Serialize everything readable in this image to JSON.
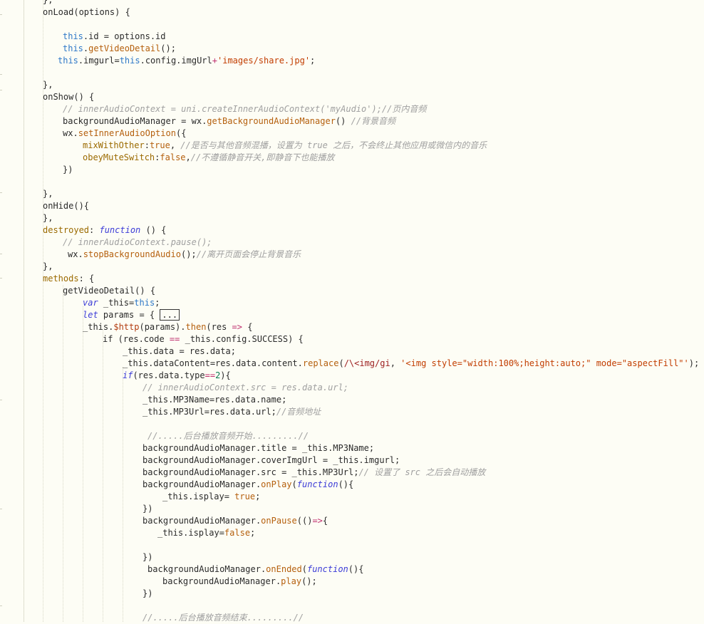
{
  "editor": {
    "lines": [
      [
        {
          "t": "plain",
          "v": "},"
        }
      ],
      [
        {
          "t": "plain",
          "v": "onLoad(options) {"
        }
      ],
      [],
      [
        {
          "t": "this",
          "v": "this"
        },
        {
          "t": "plain",
          "v": ".id = options.id"
        }
      ],
      [
        {
          "t": "this",
          "v": "this"
        },
        {
          "t": "plain",
          "v": "."
        },
        {
          "t": "fn",
          "v": "getVideoDetail"
        },
        {
          "t": "plain",
          "v": "();"
        }
      ],
      [
        {
          "t": "this",
          "v": "this"
        },
        {
          "t": "plain",
          "v": ".imgurl="
        },
        {
          "t": "this",
          "v": "this"
        },
        {
          "t": "plain",
          "v": ".config.imgUrl"
        },
        {
          "t": "op",
          "v": "+"
        },
        {
          "t": "str",
          "v": "'images/share.jpg'"
        },
        {
          "t": "plain",
          "v": ";"
        }
      ],
      [],
      [
        {
          "t": "plain",
          "v": "},"
        }
      ],
      [
        {
          "t": "plain",
          "v": "onShow() {"
        }
      ],
      [
        {
          "t": "comment",
          "v": "// innerAudioContext = uni.createInnerAudioContext('myAudio');//页内音频"
        }
      ],
      [
        {
          "t": "plain",
          "v": "backgroundAudioManager = wx."
        },
        {
          "t": "fn",
          "v": "getBackgroundAudioManager"
        },
        {
          "t": "plain",
          "v": "() "
        },
        {
          "t": "comment",
          "v": "//背景音频"
        }
      ],
      [
        {
          "t": "plain",
          "v": "wx."
        },
        {
          "t": "fn",
          "v": "setInnerAudioOption"
        },
        {
          "t": "plain",
          "v": "({"
        }
      ],
      [
        {
          "t": "prop",
          "v": "mixWithOther"
        },
        {
          "t": "plain",
          "v": ":"
        },
        {
          "t": "bool",
          "v": "true"
        },
        {
          "t": "plain",
          "v": ", "
        },
        {
          "t": "comment",
          "v": "//是否与其他音频混播，设置为 true 之后，不会终止其他应用或微信内的音乐"
        }
      ],
      [
        {
          "t": "prop",
          "v": "obeyMuteSwitch"
        },
        {
          "t": "plain",
          "v": ":"
        },
        {
          "t": "bool",
          "v": "false"
        },
        {
          "t": "plain",
          "v": ","
        },
        {
          "t": "comment",
          "v": "//不遵循静音开关,即静音下也能播放"
        }
      ],
      [
        {
          "t": "plain",
          "v": "})"
        }
      ],
      [],
      [
        {
          "t": "plain",
          "v": "},"
        }
      ],
      [
        {
          "t": "plain",
          "v": "onHide(){"
        }
      ],
      [
        {
          "t": "plain",
          "v": "},"
        }
      ],
      [
        {
          "t": "prop",
          "v": "destroyed"
        },
        {
          "t": "plain",
          "v": ": "
        },
        {
          "t": "kw",
          "v": "function"
        },
        {
          "t": "plain",
          "v": " () {"
        }
      ],
      [
        {
          "t": "comment",
          "v": "// innerAudioContext.pause();"
        }
      ],
      [
        {
          "t": "plain",
          "v": "wx."
        },
        {
          "t": "fn",
          "v": "stopBackgroundAudio"
        },
        {
          "t": "plain",
          "v": "();"
        },
        {
          "t": "comment",
          "v": "//离开页面会停止背景音乐"
        }
      ],
      [
        {
          "t": "plain",
          "v": "},"
        }
      ],
      [
        {
          "t": "prop",
          "v": "methods"
        },
        {
          "t": "plain",
          "v": ": {"
        }
      ],
      [
        {
          "t": "plain",
          "v": "getVideoDetail() {"
        }
      ],
      [
        {
          "t": "kw",
          "v": "var"
        },
        {
          "t": "plain",
          "v": " _this="
        },
        {
          "t": "this",
          "v": "this"
        },
        {
          "t": "plain",
          "v": ";"
        }
      ],
      [
        {
          "t": "kw",
          "v": "let"
        },
        {
          "t": "plain",
          "v": " params = { "
        },
        {
          "t": "fold",
          "v": "..."
        }
      ],
      [
        {
          "t": "plain",
          "v": "_this."
        },
        {
          "t": "dollar",
          "v": "$http"
        },
        {
          "t": "plain",
          "v": "(params)."
        },
        {
          "t": "fn",
          "v": "then"
        },
        {
          "t": "plain",
          "v": "(res "
        },
        {
          "t": "op",
          "v": "=>"
        },
        {
          "t": "plain",
          "v": " {"
        }
      ],
      [
        {
          "t": "plain",
          "v": "if (res.code "
        },
        {
          "t": "op",
          "v": "=="
        },
        {
          "t": "plain",
          "v": " _this.config.SUCCESS) {"
        }
      ],
      [
        {
          "t": "plain",
          "v": "_this.data = res.data;"
        }
      ],
      [
        {
          "t": "plain",
          "v": "_this.dataContent=res.data.content."
        },
        {
          "t": "fn",
          "v": "replace"
        },
        {
          "t": "plain",
          "v": "("
        },
        {
          "t": "re",
          "v": "/\\<img/gi"
        },
        {
          "t": "plain",
          "v": ", "
        },
        {
          "t": "str",
          "v": "'<img style=\"width:100%;height:auto;\" mode=\"aspectFill\"'"
        },
        {
          "t": "plain",
          "v": ");"
        }
      ],
      [
        {
          "t": "kw",
          "v": "if"
        },
        {
          "t": "plain",
          "v": "(res.data.type"
        },
        {
          "t": "op",
          "v": "=="
        },
        {
          "t": "num",
          "v": "2"
        },
        {
          "t": "plain",
          "v": "){"
        }
      ],
      [
        {
          "t": "comment",
          "v": "// innerAudioContext.src = res.data.url;"
        }
      ],
      [
        {
          "t": "plain",
          "v": "_this.MP3Name=res.data.name;"
        }
      ],
      [
        {
          "t": "plain",
          "v": "_this.MP3Url=res.data.url;"
        },
        {
          "t": "comment",
          "v": "//音频地址"
        }
      ],
      [],
      [
        {
          "t": "comment",
          "v": "//.....后台播放音频开始.........//"
        }
      ],
      [
        {
          "t": "plain",
          "v": "backgroundAudioManager.title = _this.MP3Name;"
        }
      ],
      [
        {
          "t": "plain",
          "v": "backgroundAudioManager.coverImgUrl = _this.imgurl;"
        }
      ],
      [
        {
          "t": "plain",
          "v": "backgroundAudioManager.src = _this.MP3Url;"
        },
        {
          "t": "comment",
          "v": "// 设置了 src 之后会自动播放"
        }
      ],
      [
        {
          "t": "plain",
          "v": "backgroundAudioManager."
        },
        {
          "t": "fn",
          "v": "onPlay"
        },
        {
          "t": "plain",
          "v": "("
        },
        {
          "t": "kw",
          "v": "function"
        },
        {
          "t": "plain",
          "v": "(){"
        }
      ],
      [
        {
          "t": "plain",
          "v": "_this.isplay= "
        },
        {
          "t": "bool",
          "v": "true"
        },
        {
          "t": "plain",
          "v": ";"
        }
      ],
      [
        {
          "t": "plain",
          "v": "})"
        }
      ],
      [
        {
          "t": "plain",
          "v": "backgroundAudioManager."
        },
        {
          "t": "fn",
          "v": "onPause"
        },
        {
          "t": "plain",
          "v": "(()"
        },
        {
          "t": "op",
          "v": "=>"
        },
        {
          "t": "plain",
          "v": "{"
        }
      ],
      [
        {
          "t": "plain",
          "v": "_this.isplay="
        },
        {
          "t": "bool",
          "v": "false"
        },
        {
          "t": "plain",
          "v": ";"
        }
      ],
      [],
      [
        {
          "t": "plain",
          "v": "})"
        }
      ],
      [
        {
          "t": "plain",
          "v": "backgroundAudioManager."
        },
        {
          "t": "fn",
          "v": "onEnded"
        },
        {
          "t": "plain",
          "v": "("
        },
        {
          "t": "kw",
          "v": "function"
        },
        {
          "t": "plain",
          "v": "(){"
        }
      ],
      [
        {
          "t": "plain",
          "v": "backgroundAudioManager."
        },
        {
          "t": "fn",
          "v": "play"
        },
        {
          "t": "plain",
          "v": "();"
        }
      ],
      [
        {
          "t": "plain",
          "v": "})"
        }
      ],
      [],
      [
        {
          "t": "comment",
          "v": "//.....后台播放音频结束.........//"
        }
      ]
    ]
  }
}
